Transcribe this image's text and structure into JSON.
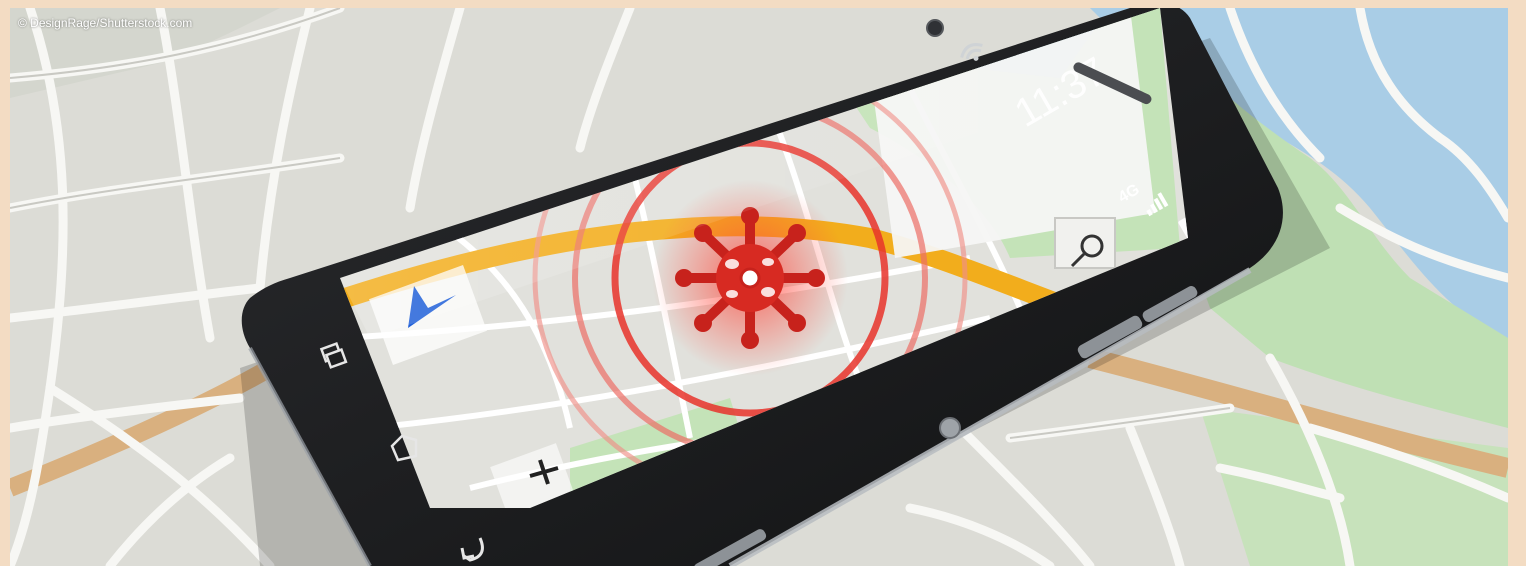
{
  "credit": "© DesignRage/Shutterstock.com",
  "phone": {
    "time": "11:37",
    "network": "4G"
  },
  "colors": {
    "frame": "#f3dcc3",
    "map_ground": "#dcdcd6",
    "map_road": "#f7f7f4",
    "map_park": "#bfe0b4",
    "map_water": "#a9cde6",
    "map_highway": "#d9b07f",
    "phone_body": "#1d1e20",
    "route": "#f2ad1c",
    "alert_red": "#e8322a"
  },
  "icons": [
    "navigation-arrow-icon",
    "virus-icon",
    "search-icon",
    "zoom-in-icon",
    "zoom-out-icon",
    "recent-apps-icon",
    "home-icon",
    "back-icon",
    "wifi-icon",
    "signal-icon",
    "battery-icon"
  ]
}
